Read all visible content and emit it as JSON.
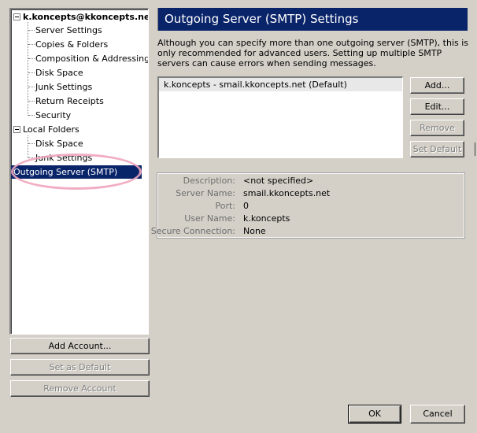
{
  "tree": {
    "account_root": "k.koncepts@kkoncepts.net",
    "account_items": [
      {
        "label": "Server Settings"
      },
      {
        "label": "Copies & Folders"
      },
      {
        "label": "Composition & Addressing"
      },
      {
        "label": "Disk Space"
      },
      {
        "label": "Junk Settings"
      },
      {
        "label": "Return Receipts"
      },
      {
        "label": "Security"
      }
    ],
    "local_root": "Local Folders",
    "local_items": [
      {
        "label": "Disk Space"
      },
      {
        "label": "Junk Settings"
      }
    ],
    "selected_item": "Outgoing Server (SMTP)"
  },
  "left_buttons": {
    "add_account": "Add Account...",
    "set_default": "Set as Default",
    "remove_account": "Remove Account"
  },
  "panel": {
    "title": "Outgoing Server (SMTP) Settings",
    "description": "Although you can specify more than one outgoing server (SMTP), this is only recommended for advanced users. Setting up multiple SMTP servers can cause errors when sending messages.",
    "servers": [
      "k.koncepts - smail.kkoncepts.net (Default)"
    ],
    "buttons": {
      "add": "Add...",
      "edit": "Edit...",
      "remove": "Remove",
      "set_default": "Set Default"
    },
    "details": {
      "description_label": "Description:",
      "description_value": "<not specified>",
      "server_name_label": "Server Name:",
      "server_name_value": "smail.kkoncepts.net",
      "port_label": "Port:",
      "port_value": "0",
      "user_name_label": "User Name:",
      "user_name_value": "k.koncepts",
      "secure_label": "Secure Connection:",
      "secure_value": "None"
    }
  },
  "dialog_buttons": {
    "ok": "OK",
    "cancel": "Cancel"
  },
  "colors": {
    "selection": "#0a246a",
    "window_bg": "#d4d0c8",
    "highlight_annotation": "#f0a5bd"
  }
}
